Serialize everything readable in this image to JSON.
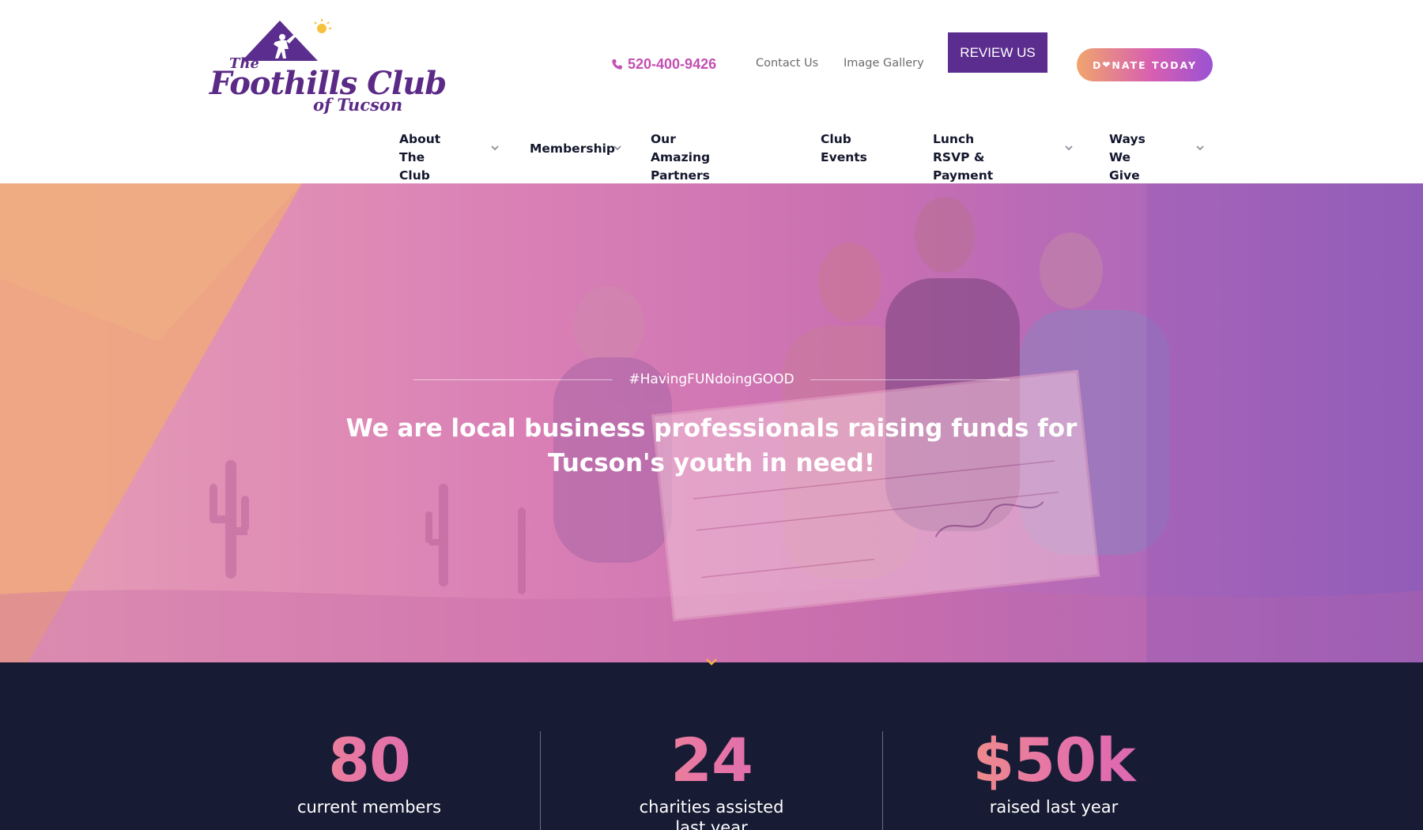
{
  "header": {
    "logo": {
      "line1": "The",
      "line2": "Foothills Club",
      "line3": "of Tucson"
    },
    "phone": "520-400-9426",
    "links": [
      {
        "label": "Contact Us"
      },
      {
        "label": "Image Gallery"
      }
    ],
    "review_label": "REVIEW US",
    "donate": {
      "before": "D",
      "after": "NATE TODAY"
    }
  },
  "nav": [
    {
      "label_line1": "About The",
      "label_line2": "Club",
      "has_dropdown": true
    },
    {
      "label_line1": "Membership",
      "label_line2": "",
      "has_dropdown": true
    },
    {
      "label_line1": "Our Amazing",
      "label_line2": "Partners",
      "has_dropdown": false
    },
    {
      "label_line1": "Club",
      "label_line2": "Events",
      "has_dropdown": false
    },
    {
      "label_line1": "Lunch RSVP &",
      "label_line2": "Payment",
      "has_dropdown": true
    },
    {
      "label_line1": "Ways We",
      "label_line2": "Give",
      "has_dropdown": true
    }
  ],
  "hero": {
    "tagline": "#HavingFUNdoingGOOD",
    "title_line1": "We are local business professionals raising funds for",
    "title_line2": "Tucson's youth in need!"
  },
  "stats": [
    {
      "value": "80",
      "label_line1": "current members",
      "label_line2": ""
    },
    {
      "value": "24",
      "label_line1": "charities assisted",
      "label_line2": "last year"
    },
    {
      "value": "$50k",
      "label_line1": "raised last year",
      "label_line2": ""
    }
  ],
  "colors": {
    "brand_purple": "#5b2d8e",
    "accent_pink": "#c34fb3",
    "dark_navy": "#171b34",
    "gradient_orange": "#f0a56d",
    "gradient_violet": "#9a52d3"
  },
  "icons": [
    "phone-icon",
    "heart-icon",
    "chevron-down-icon",
    "scroll-down-icon"
  ]
}
